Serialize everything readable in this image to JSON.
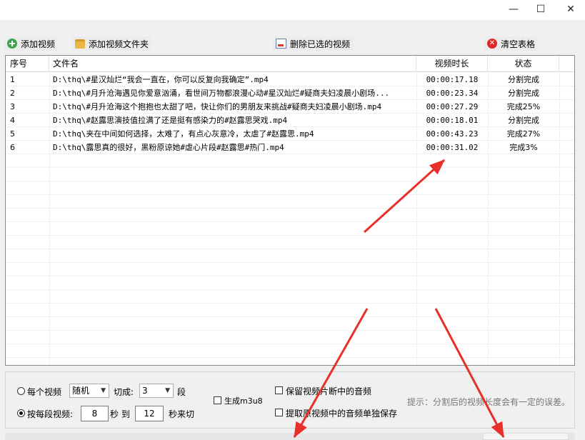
{
  "window": {
    "minimize_glyph": "—",
    "maximize_glyph": "☐",
    "close_glyph": "✕"
  },
  "toolbar": {
    "add_video": "添加视频",
    "add_folder": "添加视频文件夹",
    "delete_selected": "删除已选的视频",
    "clear_table": "清空表格"
  },
  "table": {
    "headers": {
      "index": "序号",
      "filename": "文件名",
      "duration": "视频时长",
      "status": "状态"
    },
    "rows": [
      {
        "index": "1",
        "filename": "D:\\thq\\#星汉灿烂“我会一直在，你可以反复向我确定”.mp4",
        "duration": "00:00:17.18",
        "status": "分割完成"
      },
      {
        "index": "2",
        "filename": "D:\\thq\\#月升沧海遇见你爱意汹涌，看世间万物都浪漫心动#星汉灿烂#疑商夫妇凌晨小剧场...",
        "duration": "00:00:23.34",
        "status": "分割完成"
      },
      {
        "index": "3",
        "filename": "D:\\thq\\#月升沧海这个抱抱也太甜了吧，快让你们的男朋友来挑战#疑商夫妇凌晨小剧场.mp4",
        "duration": "00:00:27.29",
        "status": "完成25%"
      },
      {
        "index": "4",
        "filename": "D:\\thq\\#赵露思演技值拉满了还是挺有感染力的#赵露思哭戏.mp4",
        "duration": "00:00:18.01",
        "status": "分割完成"
      },
      {
        "index": "5",
        "filename": "D:\\thq\\夹在中间如何选择，太难了，有点心灰意冷，太虐了#赵露思.mp4",
        "duration": "00:00:43.23",
        "status": "完成27%"
      },
      {
        "index": "6",
        "filename": "D:\\thq\\露思真的很好，黑粉原谅她#虐心片段#赵露思#热门.mp4",
        "duration": "00:00:31.02",
        "status": "完成3%"
      }
    ]
  },
  "options": {
    "per_video_label": "每个视频",
    "per_video_mode": "随机",
    "cut_into_label": "切成:",
    "cut_count": "3",
    "segments_unit": "段",
    "per_segment_label": "按每段视频:",
    "seg_min": "8",
    "sec_to_label": "秒 到",
    "seg_max": "12",
    "sec_cut_label": "秒来切",
    "gen_m3u8": "生成m3u8",
    "keep_audio": "保留视频片断中的音频",
    "extract_audio": "提取原视频中的音频单独保存",
    "hint": "提示：分割后的视频长度会有一定的误差。"
  },
  "colors": {
    "arrow": "#e8302a",
    "accent_green": "#3fa34d",
    "clear_red": "#e02828"
  }
}
